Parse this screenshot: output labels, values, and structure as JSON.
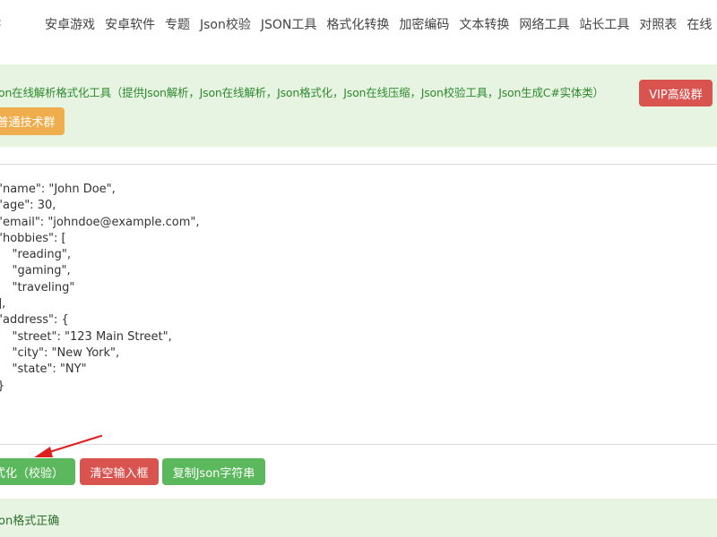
{
  "nav": {
    "logo_fragment": "‹",
    "items": [
      {
        "label": "安卓游戏"
      },
      {
        "label": "安卓软件"
      },
      {
        "label": "专题"
      },
      {
        "label": "Json校验"
      },
      {
        "label": "JSON工具"
      },
      {
        "label": "格式化转换"
      },
      {
        "label": "加密编码"
      },
      {
        "label": "文本转换"
      },
      {
        "label": "网络工具"
      },
      {
        "label": "站长工具"
      },
      {
        "label": "对照表"
      },
      {
        "label": "在线"
      }
    ]
  },
  "banner": {
    "description": "on在线解析格式化工具（提供Json解析，Json在线解析，Json格式化，Json在线压缩，Json校验工具，Json生成C#实体类）",
    "vip_button": "VIP高级群",
    "group_button": "普通技术群"
  },
  "editor": {
    "content": "\"name\": \"John Doe\",\n\"age\": 30,\n\"email\": \"johndoe@example.com\",\n\"hobbies\": [\n    \"reading\",\n    \"gaming\",\n    \"traveling\"\n],\n\"address\": {\n    \"street\": \"123 Main Street\",\n    \"city\": \"New York\",\n    \"state\": \"NY\"\n}"
  },
  "actions": {
    "format_button": "式化（校验）",
    "clear_button": "清空输入框",
    "copy_button": "复制Json字符串"
  },
  "status": {
    "message": "on格式正确"
  },
  "colors": {
    "success": "#5cb85c",
    "danger": "#d9534f",
    "warning": "#f0ad4e",
    "panel": "#e6f4e1",
    "annotation": "#e02020"
  }
}
